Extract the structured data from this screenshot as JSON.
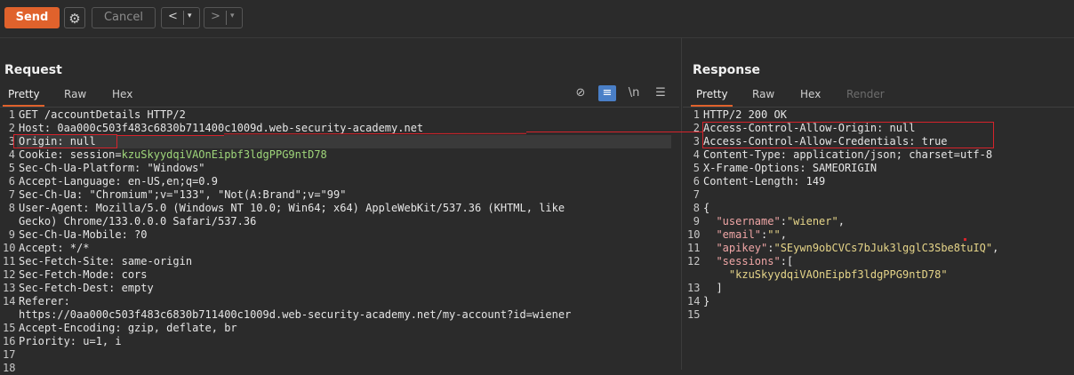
{
  "toolbar": {
    "send_label": "Send",
    "cancel_label": "Cancel",
    "back_arrow": "<",
    "forward_arrow": ">",
    "dropdown_glyph": "▾",
    "gear_glyph": "⚙"
  },
  "request": {
    "title": "Request",
    "tabs": [
      "Pretty",
      "Raw",
      "Hex"
    ],
    "active_tab": "Pretty",
    "icons": {
      "hide": "⊘",
      "wrap": "≡",
      "newline": "\\n",
      "menu": "☰"
    },
    "lines": [
      {
        "n": "1",
        "text": "GET /accountDetails HTTP/2"
      },
      {
        "n": "2",
        "text": "Host: 0aa000c503f483c6830b711400c1009d.web-security-academy.net"
      },
      {
        "n": "3",
        "text": "Origin: null"
      },
      {
        "n": "4",
        "text": "Cookie: session=kzuSkyydqiVAOnEipbf3ldgPPG9ntD78"
      },
      {
        "n": "5",
        "text": "Sec-Ch-Ua-Platform: \"Windows\""
      },
      {
        "n": "6",
        "text": "Accept-Language: en-US,en;q=0.9"
      },
      {
        "n": "7",
        "text": "Sec-Ch-Ua: \"Chromium\";v=\"133\", \"Not(A:Brand\";v=\"99\""
      },
      {
        "n": "8",
        "text": "User-Agent: Mozilla/5.0 (Windows NT 10.0; Win64; x64) AppleWebKit/537.36 (KHTML, like"
      },
      {
        "n": "",
        "text": "Gecko) Chrome/133.0.0.0 Safari/537.36"
      },
      {
        "n": "9",
        "text": "Sec-Ch-Ua-Mobile: ?0"
      },
      {
        "n": "10",
        "text": "Accept: */*"
      },
      {
        "n": "11",
        "text": "Sec-Fetch-Site: same-origin"
      },
      {
        "n": "12",
        "text": "Sec-Fetch-Mode: cors"
      },
      {
        "n": "13",
        "text": "Sec-Fetch-Dest: empty"
      },
      {
        "n": "14",
        "text": "Referer:"
      },
      {
        "n": "",
        "text": "https://0aa000c503f483c6830b711400c1009d.web-security-academy.net/my-account?id=wiener"
      },
      {
        "n": "15",
        "text": "Accept-Encoding: gzip, deflate, br"
      },
      {
        "n": "16",
        "text": "Priority: u=1, i"
      },
      {
        "n": "17",
        "text": ""
      },
      {
        "n": "18",
        "text": ""
      }
    ],
    "cookie_prefix": "Cookie: session=",
    "cookie_value": "kzuSkyydqiVAOnEipbf3ldgPPG9ntD78"
  },
  "response": {
    "title": "Response",
    "tabs": [
      "Pretty",
      "Raw",
      "Hex",
      "Render"
    ],
    "active_tab": "Pretty",
    "lines": [
      {
        "n": "1",
        "text": "HTTP/2 200 OK"
      },
      {
        "n": "2",
        "text": "Access-Control-Allow-Origin: null"
      },
      {
        "n": "3",
        "text": "Access-Control-Allow-Credentials: true"
      },
      {
        "n": "4",
        "text": "Content-Type: application/json; charset=utf-8"
      },
      {
        "n": "5",
        "text": "X-Frame-Options: SAMEORIGIN"
      },
      {
        "n": "6",
        "text": "Content-Length: 149"
      },
      {
        "n": "7",
        "text": ""
      },
      {
        "n": "8",
        "text": "{"
      },
      {
        "n": "9",
        "key": "\"username\"",
        "sep": ":",
        "val": "\"wiener\"",
        "tail": ",",
        "indent": "  "
      },
      {
        "n": "10",
        "key": "\"email\"",
        "sep": ":",
        "val": "\"\"",
        "tail": ",",
        "indent": "  "
      },
      {
        "n": "11",
        "key": "\"apikey\"",
        "sep": ":",
        "val": "\"SEywn9obCVCs7bJuk3lgglC3Sbe8tuIQ\"",
        "tail": ",",
        "indent": "  "
      },
      {
        "n": "12",
        "key": "\"sessions\"",
        "sep": ":",
        "val": "",
        "tail": "[",
        "indent": "  "
      },
      {
        "n": "",
        "key": "",
        "sep": "",
        "val": "\"kzuSkyydqiVAOnEipbf3ldgPPG9ntD78\"",
        "tail": "",
        "indent": "    "
      },
      {
        "n": "13",
        "text": "  ]"
      },
      {
        "n": "14",
        "text": "}"
      },
      {
        "n": "15",
        "text": ""
      }
    ]
  },
  "colors": {
    "accent": "#e0622c",
    "annotation": "#d6232b",
    "json_key": "#f0a6a6",
    "json_string": "#e6d589",
    "cookie": "#9fd67a"
  }
}
